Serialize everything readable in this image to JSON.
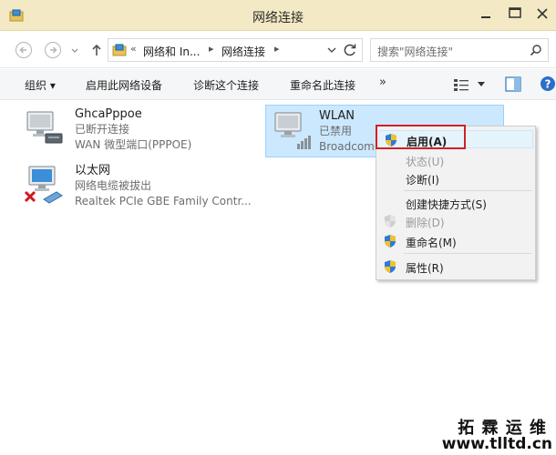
{
  "window": {
    "title": "网络连接"
  },
  "address": {
    "segments": [
      "网络和 In...",
      "网络连接"
    ],
    "prefix": "«",
    "search_placeholder": "搜索\"网络连接\""
  },
  "commands": {
    "organize": "组织 ▾",
    "enable": "启用此网络设备",
    "diagnose": "诊断这个连接",
    "rename": "重命名此连接",
    "more": "»"
  },
  "connections": [
    {
      "name": "GhcaPppoe",
      "status": "已断开连接",
      "device": "WAN 微型端口(PPPOE)"
    },
    {
      "name": "WLAN",
      "status": "已禁用",
      "device": "Broadcom"
    },
    {
      "name": "以太网",
      "status": "网络电缆被拔出",
      "device": "Realtek PCIe GBE Family Contr..."
    }
  ],
  "context_menu": {
    "items": [
      {
        "label": "启用(A)",
        "state": "bold",
        "icon": "shield-icon"
      },
      {
        "label": "状态(U)",
        "state": "disabled"
      },
      {
        "label": "诊断(I)",
        "state": "normal"
      },
      {
        "label": "创建快捷方式(S)",
        "state": "normal"
      },
      {
        "label": "删除(D)",
        "state": "disabled",
        "icon": "shield-icon"
      },
      {
        "label": "重命名(M)",
        "state": "normal",
        "icon": "shield-icon"
      },
      {
        "label": "属性(R)",
        "state": "normal",
        "icon": "shield-icon"
      }
    ]
  },
  "watermark": {
    "line1": "拓 霖 运 维",
    "line2": "www.tlltd.cn"
  },
  "colors": {
    "titlebar": "#f3e9c4",
    "selection": "#cce8ff",
    "highlight_box": "#d21f27"
  }
}
